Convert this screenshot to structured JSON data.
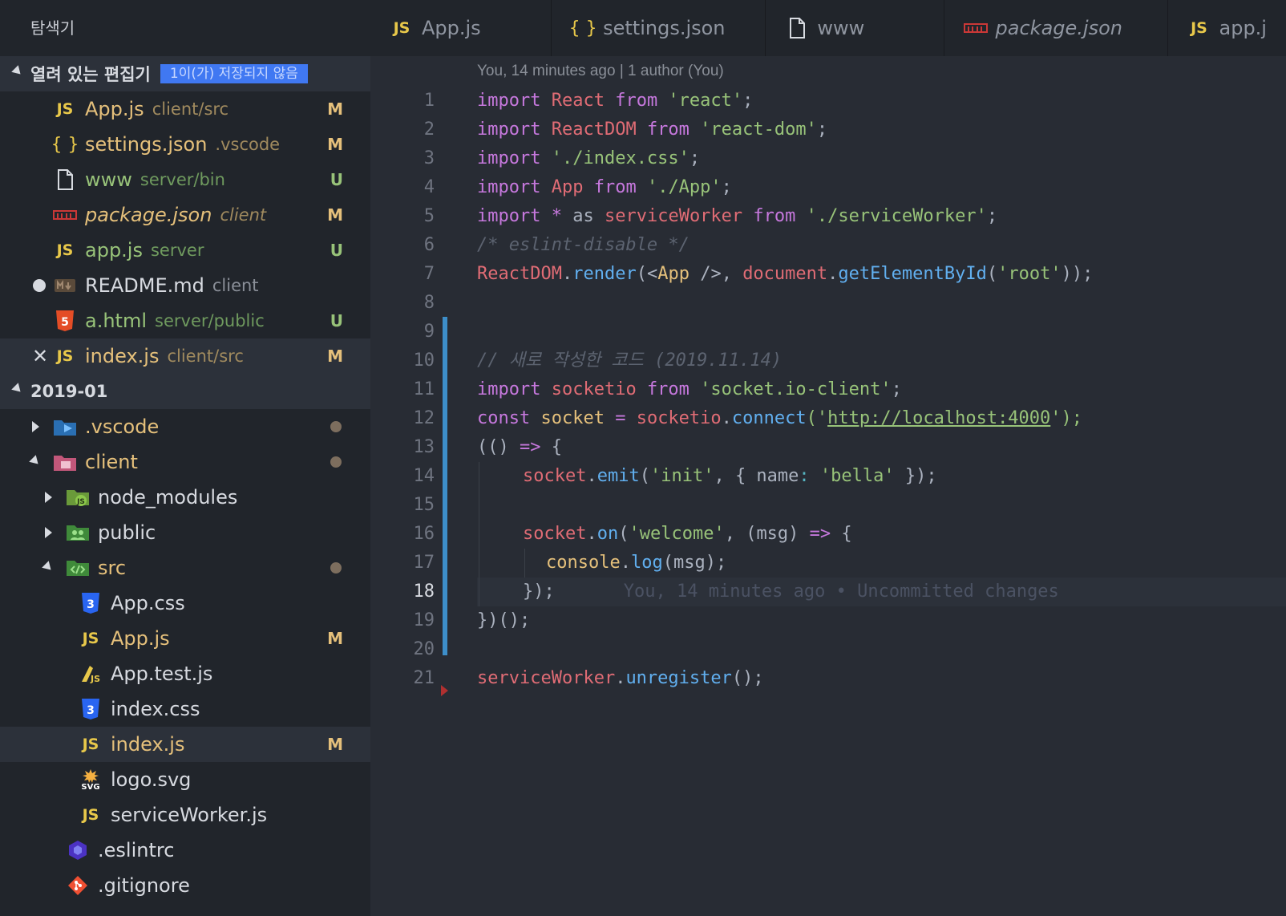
{
  "sidebar": {
    "title": "탐색기",
    "open_editors": {
      "label": "열려 있는 편집기",
      "badge": "1이(가) 저장되지 않음",
      "items": [
        {
          "name": "App.js",
          "desc": "client/src",
          "status": "M",
          "icon": "js-icon"
        },
        {
          "name": "settings.json",
          "desc": ".vscode",
          "status": "M",
          "icon": "json-icon"
        },
        {
          "name": "www",
          "desc": "server/bin",
          "status": "U",
          "icon": "file-icon"
        },
        {
          "name": "package.json",
          "desc": "client",
          "status": "M",
          "icon": "npm-icon"
        },
        {
          "name": "app.js",
          "desc": "server",
          "status": "U",
          "icon": "js-icon"
        },
        {
          "name": "README.md",
          "desc": "client",
          "status": "",
          "icon": "markdown-icon"
        },
        {
          "name": "a.html",
          "desc": "server/public",
          "status": "U",
          "icon": "html5-icon"
        },
        {
          "name": "index.js",
          "desc": "client/src",
          "status": "M",
          "icon": "js-icon"
        }
      ]
    },
    "workspace": {
      "label": "2019-01",
      "items": [
        {
          "name": ".vscode",
          "icon": "vscode-folder-icon"
        },
        {
          "name": "client",
          "icon": "folder-icon"
        },
        {
          "name": "node_modules",
          "icon": "node-folder-icon"
        },
        {
          "name": "public",
          "icon": "public-folder-icon"
        },
        {
          "name": "src",
          "icon": "src-folder-icon"
        },
        {
          "name": "App.css",
          "icon": "css3-icon"
        },
        {
          "name": "App.js",
          "status": "M",
          "icon": "js-icon"
        },
        {
          "name": "App.test.js",
          "icon": "test-js-icon"
        },
        {
          "name": "index.css",
          "icon": "css3-icon"
        },
        {
          "name": "index.js",
          "status": "M",
          "icon": "js-icon"
        },
        {
          "name": "logo.svg",
          "icon": "svg-icon"
        },
        {
          "name": "serviceWorker.js",
          "icon": "js-icon"
        },
        {
          "name": ".eslintrc",
          "icon": "eslint-icon"
        },
        {
          "name": ".gitignore",
          "icon": "git-icon"
        }
      ]
    }
  },
  "tabs": [
    {
      "label": "App.js",
      "icon": "js-icon"
    },
    {
      "label": "settings.json",
      "icon": "json-icon"
    },
    {
      "label": "www",
      "icon": "file-icon"
    },
    {
      "label": "package.json",
      "icon": "npm-icon"
    },
    {
      "label": "app.j",
      "icon": "js-icon"
    }
  ],
  "editor": {
    "blame_header": "You, 14 minutes ago | 1 author (You)",
    "current_line": "18",
    "line_numbers": [
      "1",
      "2",
      "3",
      "4",
      "5",
      "6",
      "7",
      "8",
      "9",
      "10",
      "11",
      "12",
      "13",
      "14",
      "15",
      "16",
      "17",
      "18",
      "19",
      "20",
      "21"
    ],
    "code": {
      "l1": [
        "import",
        " React ",
        "from",
        " 'react'",
        ";"
      ],
      "l2": [
        "import",
        " ReactDOM ",
        "from",
        " 'react-dom'",
        ";"
      ],
      "l3": [
        "import",
        " './index.css'",
        ";"
      ],
      "l4": [
        "import",
        " App ",
        "from",
        " './App'",
        ";"
      ],
      "l5": [
        "import",
        " * ",
        "as",
        " serviceWorker ",
        "from",
        " './serviceWorker'",
        ";"
      ],
      "l6": "/* eslint-disable */",
      "l7": [
        "ReactDOM",
        ".",
        "render",
        "(<",
        "App",
        " />, ",
        "document",
        ".",
        "getElementById",
        "(",
        "'root'",
        "));"
      ],
      "l10": "// 새로 작성한 코드 (2019.11.14)",
      "l11": [
        "import",
        " socketio ",
        "from",
        " 'socket.io-client'",
        ";"
      ],
      "l12": [
        "const",
        " socket ",
        "=",
        " socketio",
        ".",
        "connect",
        "('",
        "http://localhost:4000",
        "');"
      ],
      "l13": [
        "(() ",
        "=>",
        " {"
      ],
      "l14": [
        "socket",
        ".",
        "emit",
        "(",
        "'init'",
        ", { name",
        ":",
        " 'bella'",
        " });"
      ],
      "l16": [
        "socket",
        ".",
        "on",
        "(",
        "'welcome'",
        ", (msg) ",
        "=>",
        " {"
      ],
      "l17": [
        "console",
        ".",
        "log",
        "(msg);"
      ],
      "l18": "});",
      "l18_ghost": "You, 14 minutes ago • Uncommitted changes",
      "l19": "})();",
      "l21": [
        "serviceWorker",
        ".",
        "unregister",
        "();"
      ]
    }
  },
  "colors": {
    "modified": "#e5c07b",
    "untracked": "#98c379",
    "accent": "#4078f2",
    "changebar": "#3d8ec9"
  }
}
